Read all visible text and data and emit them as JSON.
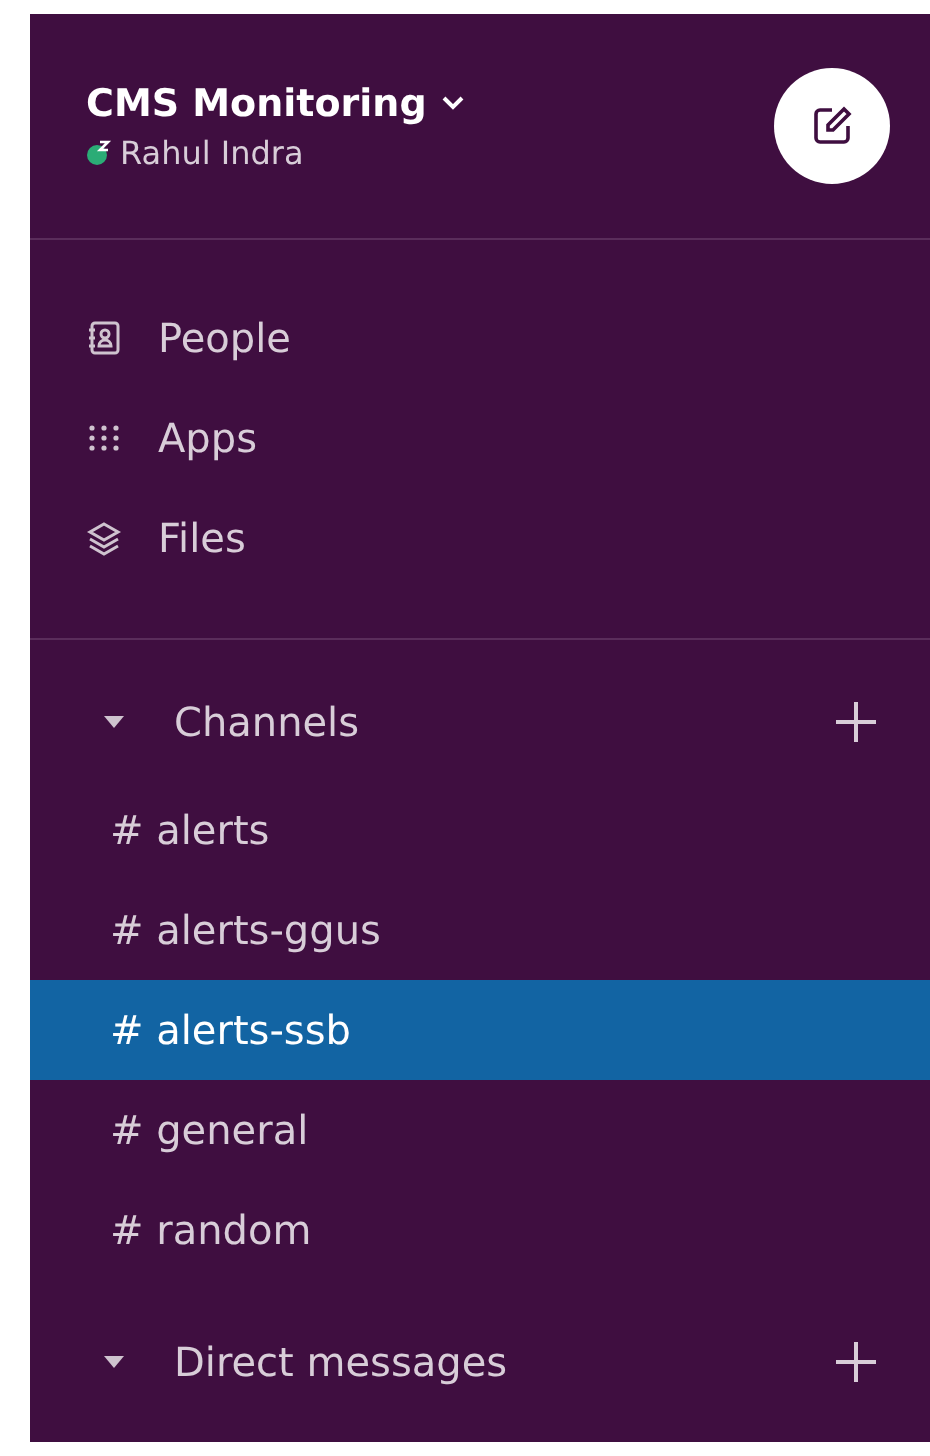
{
  "workspace": {
    "name": "CMS Monitoring",
    "user": "Rahul Indra",
    "away": true
  },
  "nav": [
    {
      "kind": "people",
      "label": "People"
    },
    {
      "kind": "apps",
      "label": "Apps"
    },
    {
      "kind": "files",
      "label": "Files"
    }
  ],
  "sections": [
    {
      "title": "Channels",
      "expanded": true,
      "items": [
        {
          "label": "# alerts",
          "selected": false
        },
        {
          "label": "# alerts-ggus",
          "selected": false
        },
        {
          "label": "# alerts-ssb",
          "selected": true
        },
        {
          "label": "# general",
          "selected": false
        },
        {
          "label": "# random",
          "selected": false
        }
      ]
    },
    {
      "title": "Direct messages",
      "expanded": true
    }
  ]
}
